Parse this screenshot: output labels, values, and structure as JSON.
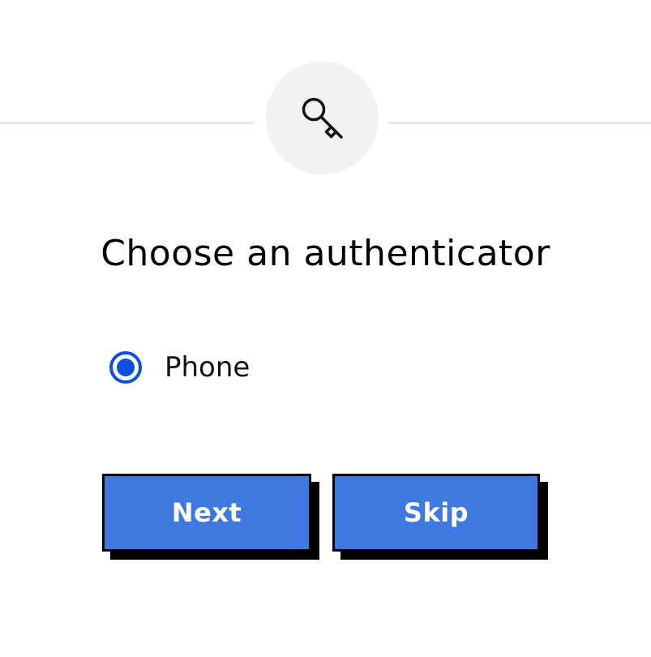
{
  "header": {
    "icon": "key-icon"
  },
  "title": "Choose an authenticator",
  "options": [
    {
      "label": "Phone",
      "selected": true,
      "icon": "radio-selected"
    }
  ],
  "buttons": {
    "next_label": "Next",
    "skip_label": "Skip"
  },
  "colors": {
    "accent": "#0b4fe0",
    "button": "#3f78de",
    "badge_bg": "#f2f2f2",
    "divider": "#e9e9e9",
    "text": "#000000"
  }
}
